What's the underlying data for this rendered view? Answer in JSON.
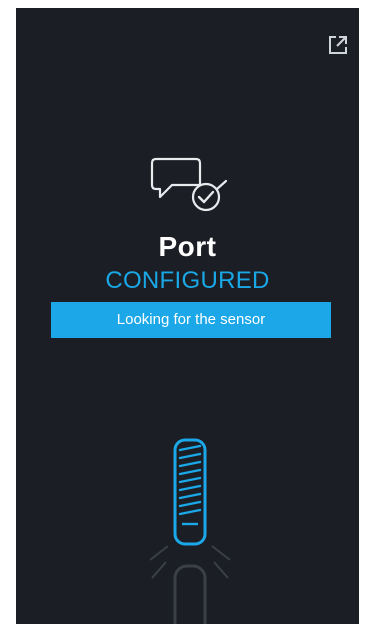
{
  "header": {
    "open_external_icon": "external-link-icon"
  },
  "main": {
    "icon": "port-configured-icon",
    "title": "Port",
    "status": "CONFIGURED",
    "banner": "Looking for the sensor"
  },
  "illustration": {
    "icon": "sensor-connector-icon"
  },
  "colors": {
    "background": "#1b1e24",
    "accent": "#1ba7e8",
    "text": "#ffffff"
  }
}
